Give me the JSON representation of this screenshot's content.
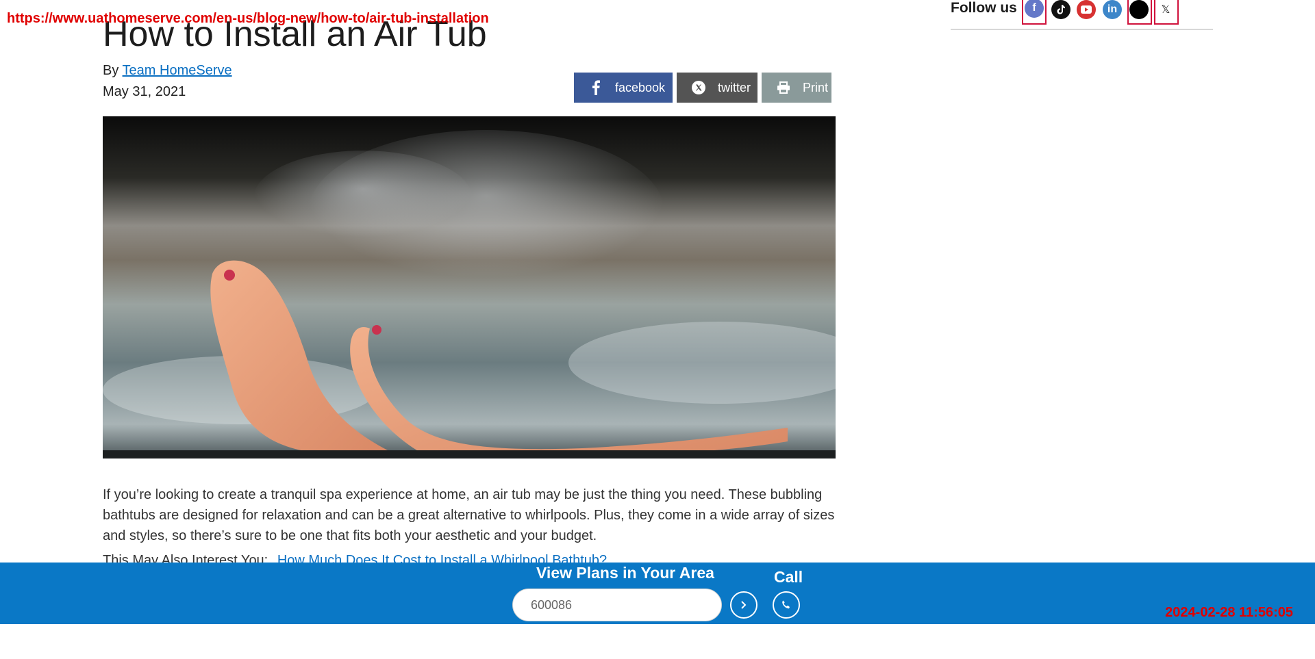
{
  "overlay": {
    "url": "https://www.uathomeserve.com/en-us/blog-new/how-to/air-tub-installation",
    "timestamp": "2024-02-28 11:56:05"
  },
  "article": {
    "title": "How to Install an Air Tub",
    "by_prefix": "By",
    "author": "Team HomeServe",
    "date": "May 31, 2021",
    "hero_image": "feet-in-air-tub-photo",
    "intro": "If you’re looking to create a tranquil spa experience at home, an air tub may be just the thing you need. These bubbling bathtubs are designed for relaxation and can be a great alternative to whirlpools. Plus, they come in a wide array of sizes and styles, so there’s sure to be one that fits both your aesthetic and your budget.",
    "also_prefix": "This May Also Interest You:",
    "also_link": "How Much Does It Cost to Install a Whirlpool Bathtub?"
  },
  "share": {
    "facebook": "facebook",
    "twitter": "twitter",
    "print": "Print",
    "colors": {
      "facebook": "#3b5998",
      "twitter": "#545454",
      "print": "#8a9a9a"
    }
  },
  "follow": {
    "label": "Follow us",
    "icons": [
      "facebook-icon",
      "tiktok-icon",
      "youtube-icon",
      "linkedin-icon",
      "threads-icon",
      "x-icon"
    ]
  },
  "bottom_bar": {
    "title": "View Plans in Your Area",
    "zip_value": "600086",
    "call_label": "Call",
    "color": "#0a78c6"
  }
}
